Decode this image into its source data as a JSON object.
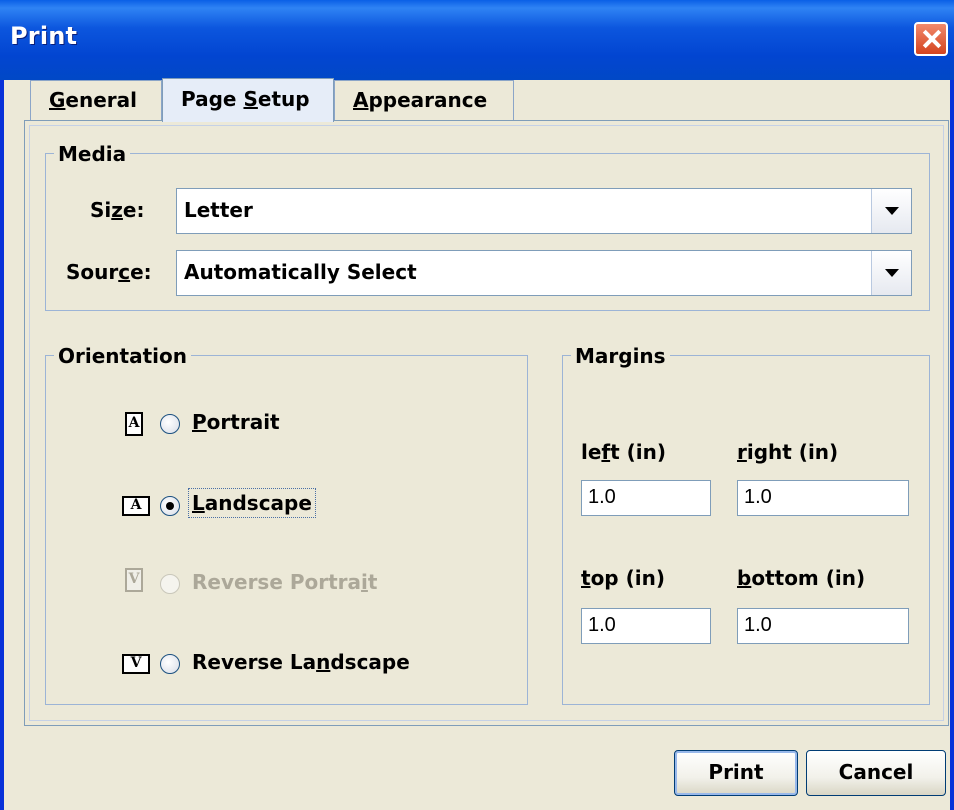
{
  "window": {
    "title": "Print"
  },
  "tabs": [
    {
      "label": "General",
      "mnemonic": "G",
      "active": false
    },
    {
      "label": "Page Setup",
      "mnemonic": "S",
      "active": true
    },
    {
      "label": "Appearance",
      "mnemonic": "A",
      "active": false
    }
  ],
  "media": {
    "group_title": "Media",
    "size_label": "Size:",
    "size_value": "Letter",
    "source_label": "Source:",
    "source_value": "Automatically Select"
  },
  "orientation": {
    "group_title": "Orientation",
    "options": [
      {
        "label": "Portrait",
        "icon": "portrait-page-icon",
        "selected": false,
        "enabled": true
      },
      {
        "label": "Landscape",
        "icon": "landscape-page-icon",
        "selected": true,
        "enabled": true
      },
      {
        "label": "Reverse Portrait",
        "icon": "reverse-portrait-page-icon",
        "selected": false,
        "enabled": false
      },
      {
        "label": "Reverse Landscape",
        "icon": "reverse-landscape-page-icon",
        "selected": false,
        "enabled": true
      }
    ]
  },
  "margins": {
    "group_title": "Margins",
    "left_label": "left (in)",
    "right_label": "right (in)",
    "top_label": "top (in)",
    "bottom_label": "bottom (in)",
    "left_value": "1.0",
    "right_value": "1.0",
    "top_value": "1.0",
    "bottom_value": "1.0"
  },
  "buttons": {
    "print_label": "Print",
    "cancel_label": "Cancel"
  },
  "colors": {
    "titlebar": "#0245d1",
    "close_button": "#d4431f",
    "dialog_bg": "#ece9d8"
  }
}
